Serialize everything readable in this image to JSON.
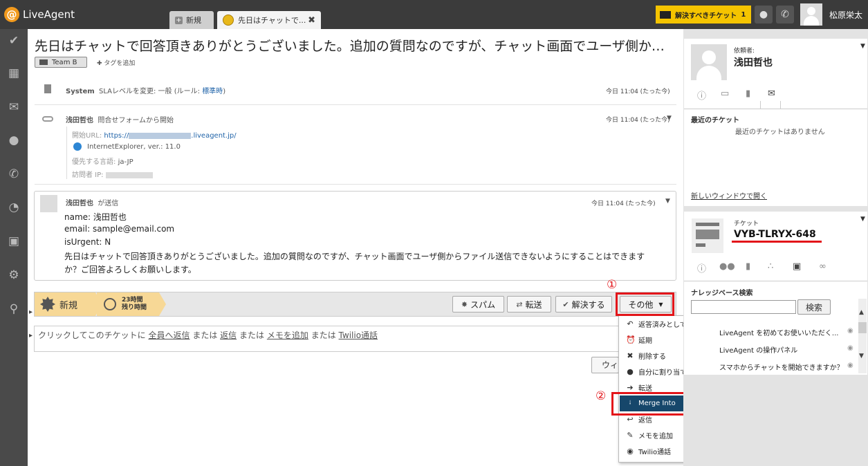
{
  "app": {
    "logo_text": "LiveAgent",
    "logo_icon": "at-sign-logo",
    "brand_color": "#f29a1d"
  },
  "tabs": [
    {
      "label": "新規",
      "icon": "plus-icon"
    },
    {
      "label": "先日はチャットで...",
      "icon": "chat-ticket-icon",
      "close": "✖"
    }
  ],
  "topbar": {
    "pending_label": "解決すべきチケット",
    "pending_count": "1",
    "user_name": "松原栄太",
    "highlight_color": "#f5c400"
  },
  "sidebar": [
    "check-icon",
    "dashboard-icon",
    "email-icon",
    "chat-icon",
    "phone-icon",
    "reports-icon",
    "knowledgebase-icon",
    "settings-icon",
    "search-icon"
  ],
  "ticket": {
    "title": "先日はチャットで回答頂きありがとうございました。追加の質問なのですが、チャット画面でユーザ側からファイル送信できないようにすることはできますか？ご回答よろしくお願いします。",
    "tag": "Team B",
    "add_tag": "タグを追加"
  },
  "events": {
    "system": {
      "author": "System",
      "text": "SLAレベルを変更: 一般 (ルール: ",
      "rule": "標準時",
      "close": ")",
      "time": "今日 11:04 (たった今)"
    },
    "contact": {
      "author": "浅田哲也",
      "text": "問合せフォームから開始",
      "time": "今日 11:04 (たった今)",
      "url_label": "開始URL:",
      "url_prefix": "https://",
      "url_suffix": ".liveagent.jp/",
      "browser": "InternetExplorer, ver.: 11.0",
      "lang_label": "優先する言語:",
      "lang": "ja-JP",
      "ip_label": "訪問者 IP:"
    },
    "message": {
      "author": "浅田哲也",
      "action": "が送信",
      "time": "今日 11:04 (たった今)",
      "lines": [
        "name: 浅田哲也",
        "email: sample@email.com",
        "isUrgent: N",
        "先日はチャットで回答頂きありがとうございました。追加の質問なのですが、チャット画面でユーザ側からファイル送信できないようにすることはできます",
        "か？ご回答よろしくお願いします。"
      ]
    }
  },
  "status": {
    "state": "新規",
    "time_big": "23時間",
    "time_small": "残り時間"
  },
  "actions": {
    "spam": "スパム",
    "forward": "転送",
    "resolve": "解決する",
    "other": "その他"
  },
  "reply": {
    "prefix": "クリックしてこのチケットに",
    "reply_all": "全員へ返信",
    "or1": "または",
    "reply": "返信",
    "or2": "または",
    "note": "メモを追加",
    "or3": "または",
    "call": "Twilio通話",
    "window_btn": "ウィンドウ"
  },
  "dropdown": [
    {
      "label": "返答済みとしてマーク",
      "icon": "undo-icon"
    },
    {
      "label": "延期",
      "icon": "alarm-icon"
    },
    {
      "label": "削除する",
      "icon": "x-icon"
    },
    {
      "label": "自分に割り当てる",
      "icon": "person-icon"
    },
    {
      "label": "転送",
      "icon": "arrow-right-icon"
    },
    {
      "label": "Merge Into",
      "icon": "merge-icon",
      "selected": true
    },
    {
      "label": "返信",
      "icon": "reply-icon"
    },
    {
      "label": "メモを追加",
      "icon": "note-icon"
    },
    {
      "label": "Twilio通話",
      "icon": "twilio-icon"
    }
  ],
  "annotations": {
    "one": "①",
    "two": "②",
    "color": "#e3151a"
  },
  "right": {
    "requester_label": "依頼者:",
    "requester_name": "浅田哲也",
    "recent_label": "最近のチケット",
    "no_recent": "最近のチケットはありません",
    "new_window": "新しいウィンドウで開く",
    "ticket_label": "チケット",
    "ticket_id": "VYB-TLRYX-648",
    "kb_title": "ナレッジベース検索",
    "kb_search_btn": "検索",
    "kb_items": [
      "LiveAgent を初めてお使いいただく...",
      "LiveAgent の操作パネル",
      "スマホからチャットを開始できますか？"
    ]
  }
}
